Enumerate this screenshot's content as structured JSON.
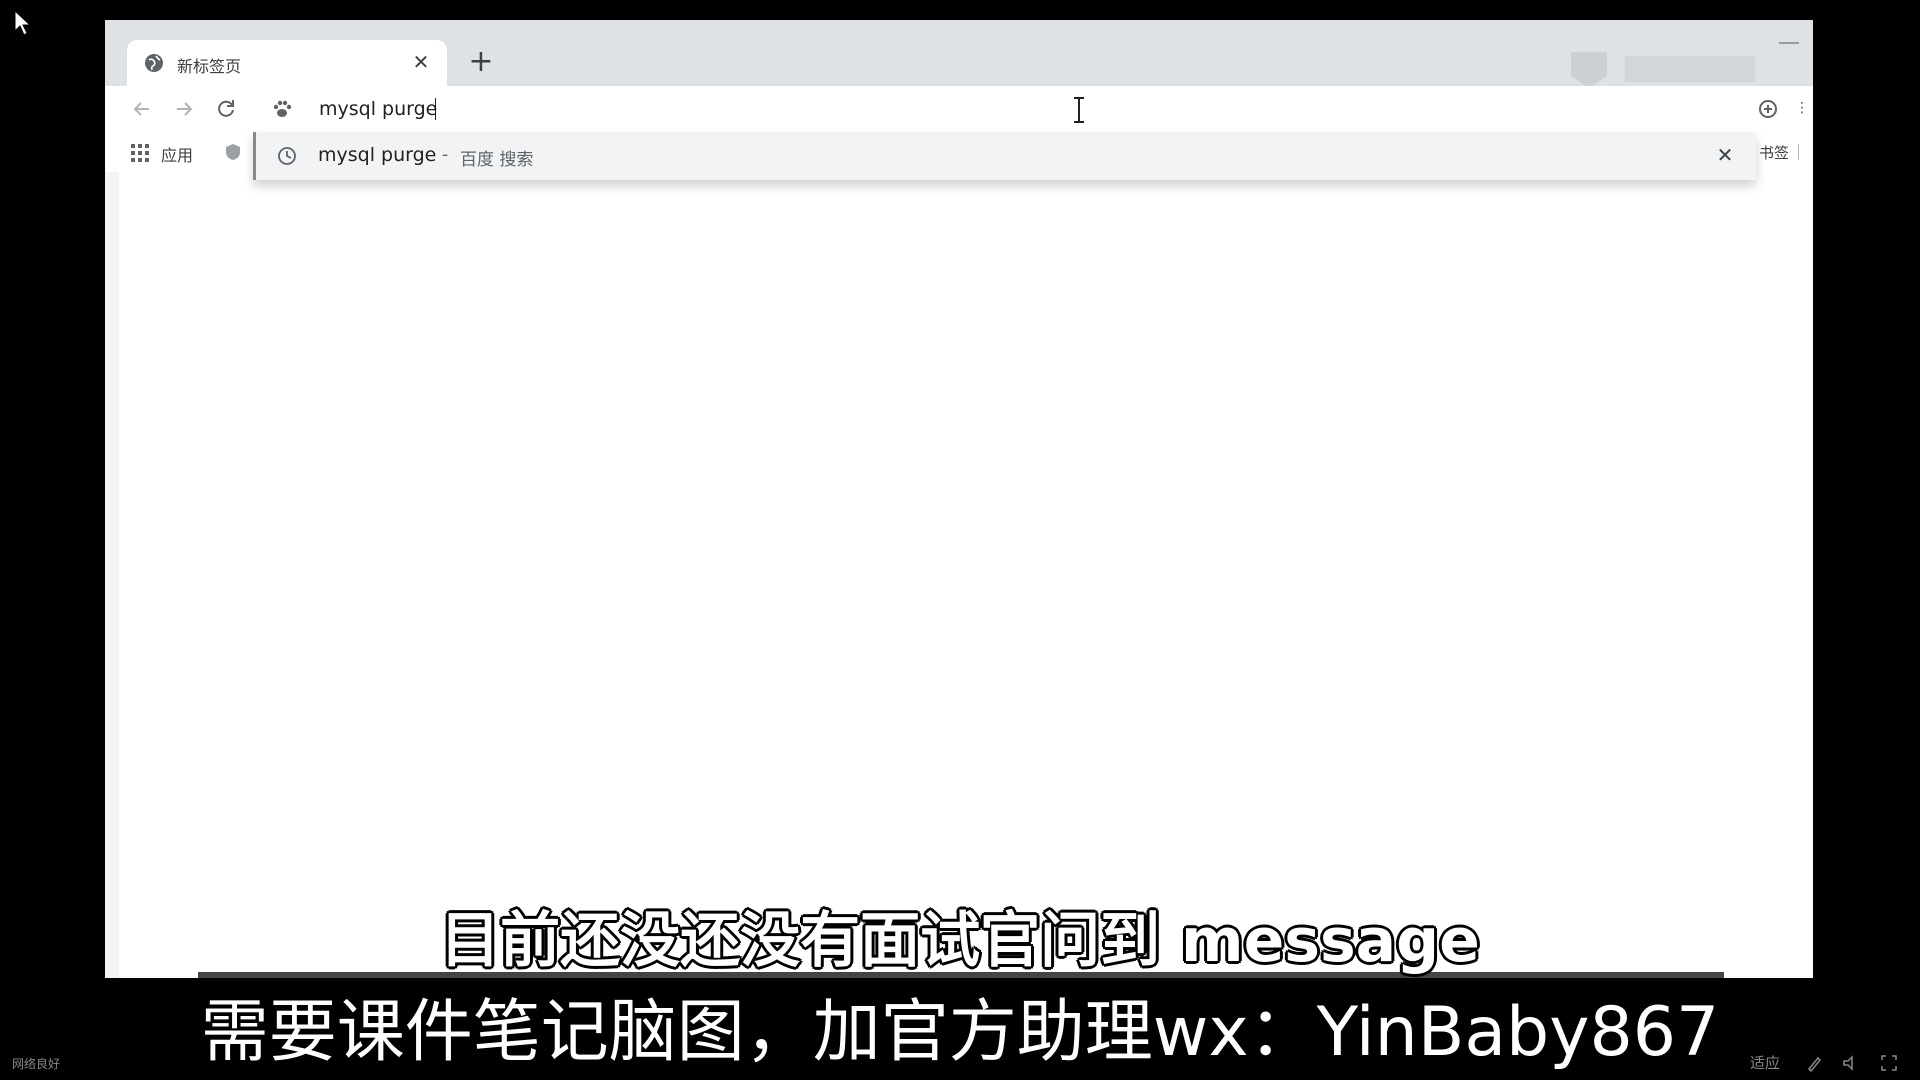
{
  "tab": {
    "title": "新标签页",
    "close": "✕"
  },
  "new_tab": "+",
  "omnibox": {
    "value": "mysql purge"
  },
  "bookmarks": {
    "apps_label": "应用",
    "right_label": "书签"
  },
  "suggestion": {
    "query": "mysql purge",
    "separator": "-",
    "engine": "百度 搜索",
    "remove": "✕"
  },
  "subtitles": {
    "line1": "目前还没还没有面试官问到 message",
    "banner": "需要课件笔记脑图，加官方助理wx：YinBaby867"
  },
  "taskbar": {
    "left_label": "网络良好",
    "right_label": "适应"
  },
  "icons": {
    "cursor": "mouse-pointer-icon",
    "favicon": "globe-icon",
    "back": "arrow-left-icon",
    "forward": "arrow-right-icon",
    "reload": "reload-icon",
    "engine": "paw-icon",
    "history": "clock-icon",
    "apps": "grid-icon"
  },
  "colors": {
    "tabstrip": "#dee1e6",
    "suggestion_bg": "#f1f3f4",
    "text": "#202124"
  }
}
